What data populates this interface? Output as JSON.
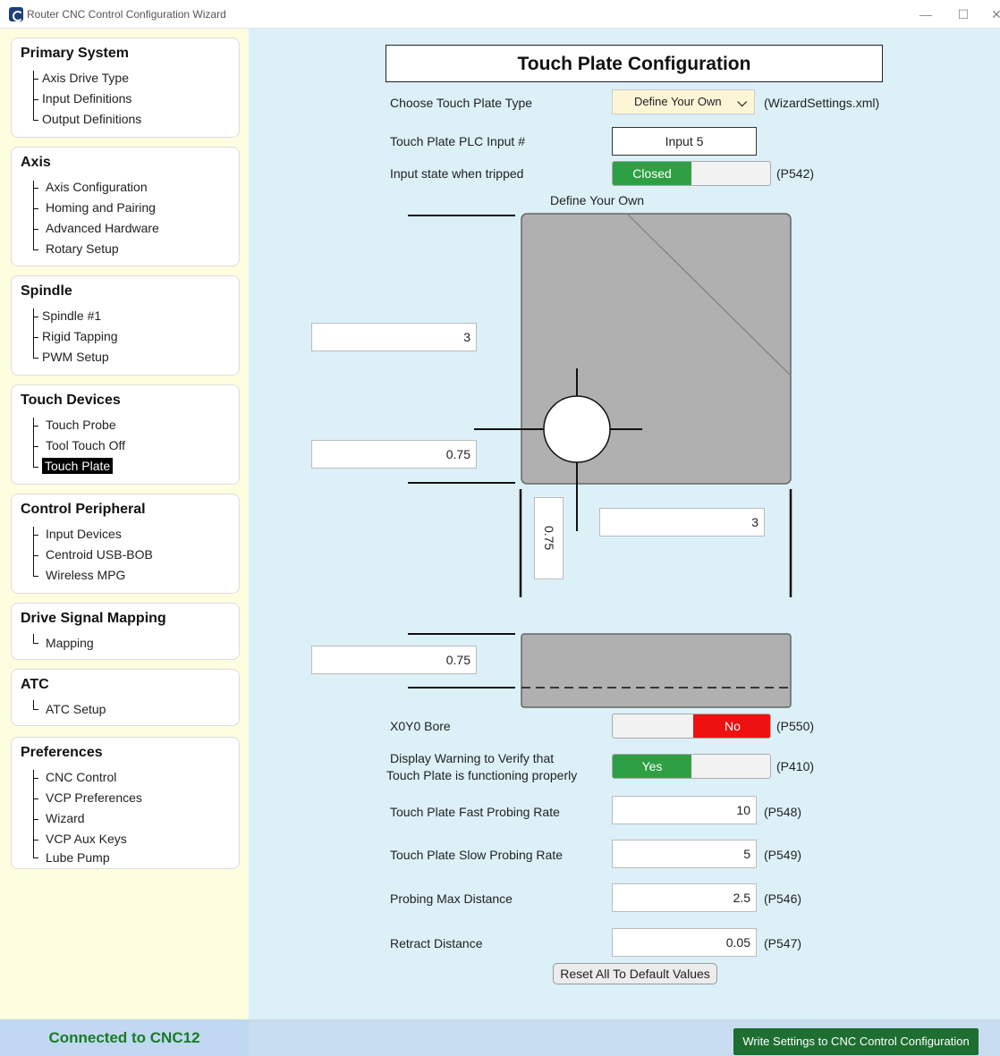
{
  "window": {
    "title": "Router CNC Control Configuration Wizard",
    "minimize": "—",
    "maximize": "☐",
    "close": "✕"
  },
  "sidebar": {
    "groups": [
      {
        "title": "Primary System",
        "items": [
          "Axis Drive Type",
          "Input Definitions",
          "Output Definitions"
        ]
      },
      {
        "title": "Axis",
        "items": [
          "Axis Configuration",
          "Homing and Pairing",
          "Advanced Hardware",
          "Rotary Setup"
        ]
      },
      {
        "title": "Spindle",
        "items": [
          "Spindle #1",
          "Rigid Tapping",
          "PWM Setup"
        ]
      },
      {
        "title": "Touch Devices",
        "items": [
          "Touch Probe",
          "Tool Touch Off",
          "Touch Plate"
        ]
      },
      {
        "title": "Control Peripheral",
        "items": [
          "Input Devices",
          "Centroid USB-BOB",
          "Wireless MPG"
        ]
      },
      {
        "title": "Drive Signal Mapping",
        "items": [
          "Mapping"
        ]
      },
      {
        "title": "ATC",
        "items": [
          "ATC Setup"
        ]
      },
      {
        "title": "Preferences",
        "items": [
          "CNC Control",
          "VCP Preferences",
          "Wizard",
          "VCP Aux Keys",
          "Lube Pump"
        ]
      }
    ],
    "selected": "Touch Plate"
  },
  "main": {
    "title": "Touch Plate Configuration",
    "plate_type": {
      "label": "Choose Touch Plate Type",
      "value": "Define Your Own",
      "source": "(WizardSettings.xml)"
    },
    "plc_input": {
      "label": "Touch Plate PLC Input #",
      "value": "Input 5"
    },
    "input_state": {
      "label": "Input state when tripped",
      "value": "Closed",
      "param": "(P542)"
    },
    "diagram": {
      "caption": "Define Your Own",
      "height_value": "3",
      "hole_offset_y": "0.75",
      "hole_offset_x": "0.75",
      "width_value": "3",
      "thickness": "0.75"
    },
    "bore": {
      "label": "X0Y0 Bore",
      "value": "No",
      "param": "(P550)"
    },
    "warning": {
      "label_line1": "Display Warning to Verify that",
      "label_line2": "Touch Plate is functioning properly",
      "value": "Yes",
      "param": "(P410)"
    },
    "fast_rate": {
      "label": "Touch Plate Fast Probing Rate",
      "value": "10",
      "param": "(P548)"
    },
    "slow_rate": {
      "label": "Touch Plate Slow Probing Rate",
      "value": "5",
      "param": "(P549)"
    },
    "max_distance": {
      "label": "Probing Max Distance",
      "value": "2.5",
      "param": "(P546)"
    },
    "retract": {
      "label": "Retract Distance",
      "value": "0.05",
      "param": "(P547)"
    },
    "reset_label": "Reset All To Default Values"
  },
  "status": {
    "connection": "Connected to CNC12",
    "write_label": "Write Settings to CNC Control Configuration"
  },
  "colors": {
    "toggle_on": "#2ea043",
    "toggle_off_red": "#ee1111",
    "sidebar_bg": "#fdfde0",
    "main_bg": "#dcf0f8",
    "connected_text": "#1a7a28"
  }
}
